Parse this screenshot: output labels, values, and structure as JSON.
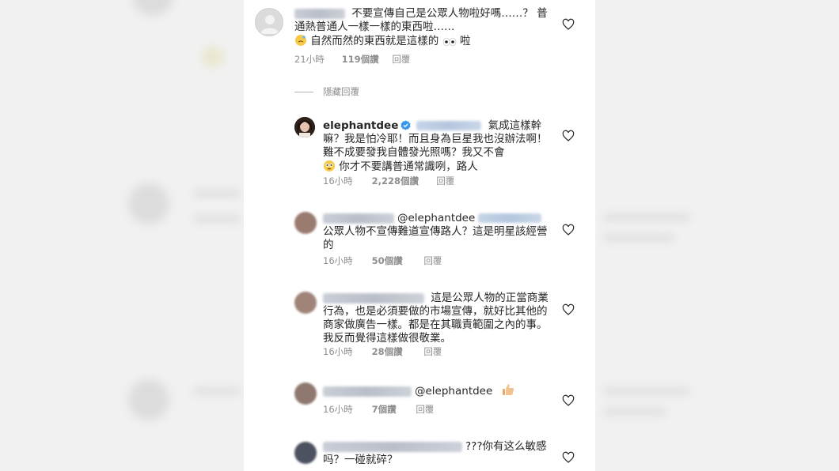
{
  "comments": [
    {
      "text": "不要宣傳自己是公眾人物啦好嗎……？ 普通熱普通人一樣一樣的東西啦…… ",
      "text2": "自然而然的東西就是這樣的",
      "text3": "啦",
      "time": "21小時",
      "likes": "119個讚",
      "reply": "回覆"
    },
    {
      "hide_replies": "隱藏回覆"
    },
    {
      "username": "elephantdee",
      "text": "氣成這樣幹嘛？我是怕冷耶！而且身為巨星我也沒辦法啊！難不成要發我自體發光照嗎？我又不會",
      "text2": "你才不要講普通常識咧，路人",
      "time": "16小時",
      "likes": "2,228個讚",
      "reply": "回覆"
    },
    {
      "mention": "@elephantdee",
      "text": "公眾人物不宣傳難道宣傳路人？這是明星該經營的",
      "time": "16小時",
      "likes": "50個讚",
      "reply": "回覆"
    },
    {
      "text": "這是公眾人物的正當商業行為，也是必須要做的市場宣傳，就好比其他的商家做廣告一樣。都是在其職責範圍之內的事。我反而覺得這樣做很敬業。",
      "time": "16小時",
      "likes": "28個讚",
      "reply": "回覆"
    },
    {
      "mention": "@elephantdee",
      "time": "16小時",
      "likes": "7個讚",
      "reply": "回覆"
    },
    {
      "text": "???你有这么敏感吗？一碰就碎？"
    }
  ],
  "colors": {
    "verified": "#3897f0",
    "text": "#262626",
    "meta": "#8e8e8e"
  },
  "icons": [
    "heart-outline-icon",
    "verified-badge-icon",
    "thumbs-up-emoji",
    "sweat-emoji",
    "eyes-emoji",
    "flushed-emoji"
  ]
}
